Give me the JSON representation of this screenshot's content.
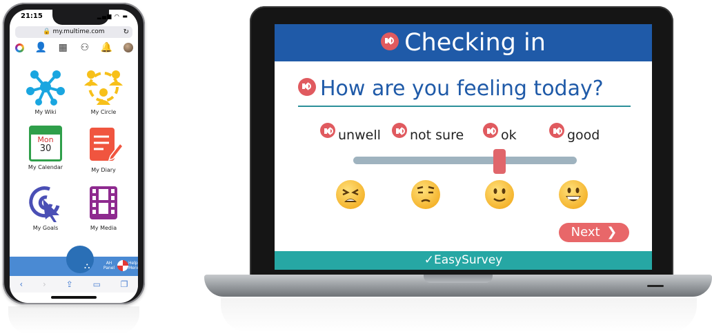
{
  "phone": {
    "status_time": "21:15",
    "url": "my.multime.com",
    "apps": [
      {
        "label": "My Wiki",
        "icon": "network-icon"
      },
      {
        "label": "My Circle",
        "icon": "people-circle-icon"
      },
      {
        "label": "My Calendar",
        "icon": "calendar-icon"
      },
      {
        "label": "My Diary",
        "icon": "diary-icon"
      },
      {
        "label": "My Goals",
        "icon": "target-icon"
      },
      {
        "label": "My Media",
        "icon": "film-icon"
      }
    ],
    "calendar_day": "Mon",
    "calendar_date": "30",
    "ah_panel_label": "AH Panel",
    "help_menu_label": "Help Menu"
  },
  "survey": {
    "title": "Checking in",
    "question": "How are you feeling today?",
    "options": [
      "unwell",
      "not sure",
      "ok",
      "good"
    ],
    "slider_value": 2,
    "next_label": "Next",
    "footer": "EasySurvey",
    "colors": {
      "header": "#1f5aa8",
      "footer": "#26a7a4",
      "accent": "#e05a5f"
    }
  }
}
